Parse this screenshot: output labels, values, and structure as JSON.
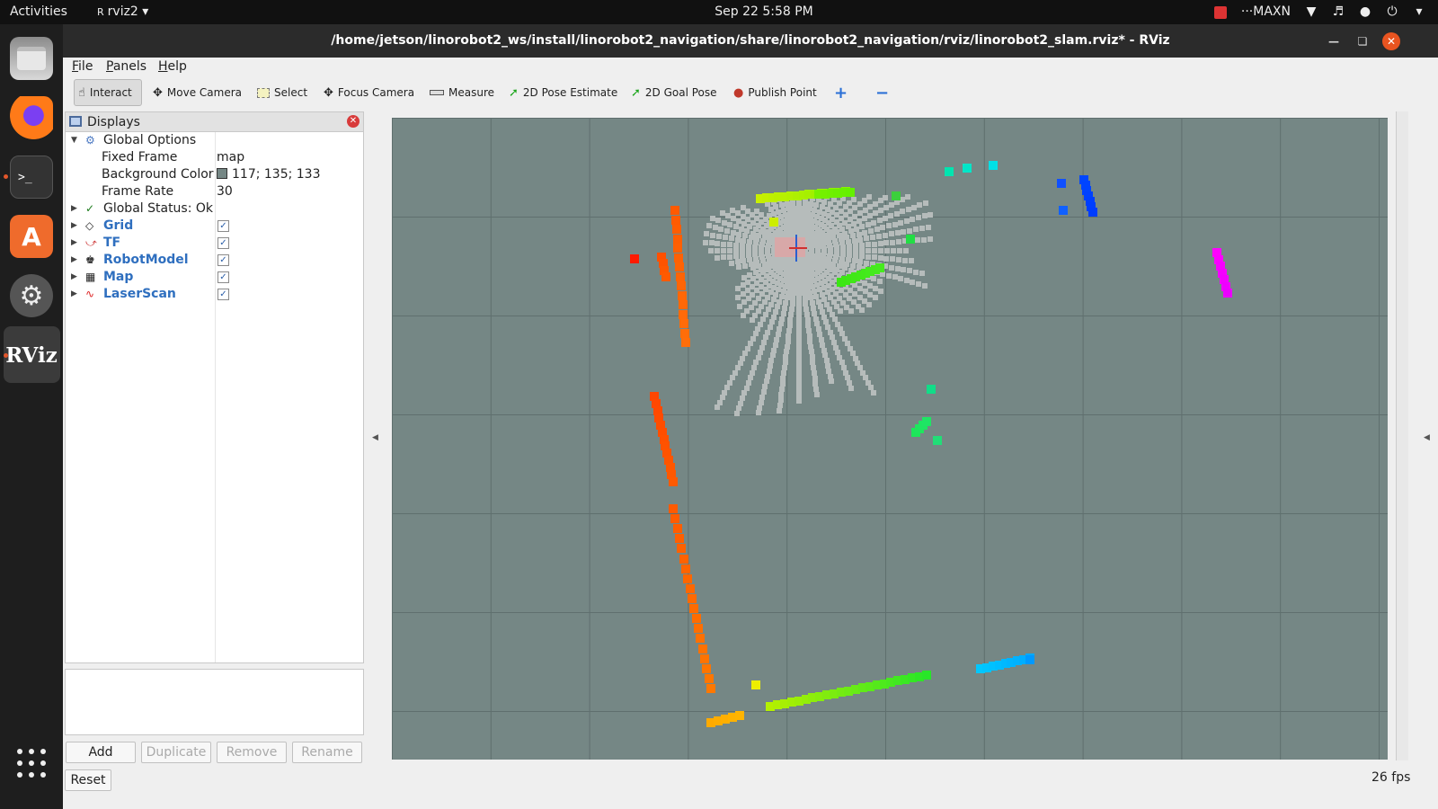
{
  "topbar": {
    "activities": "Activities",
    "app_name": "rviz2",
    "clock": "Sep 22  5:58 PM",
    "power_mode": "MAXN",
    "icons": [
      "jetson-status-icon",
      "wifi-icon",
      "volume-icon",
      "microphone-icon",
      "power-icon"
    ]
  },
  "dock": {
    "apps": [
      "Files",
      "Firefox",
      "Terminal",
      "Ubuntu Software",
      "Settings",
      "RViz"
    ],
    "rviz_label": "RViz",
    "terminal_glyph": ">_"
  },
  "window": {
    "title": "/home/jetson/linorobot2_ws/install/linorobot2_navigation/share/linorobot2_navigation/rviz/linorobot2_slam.rviz* - RViz"
  },
  "menu": {
    "file": "File",
    "panels": "Panels",
    "help": "Help"
  },
  "toolbar": {
    "interact": "Interact",
    "move_camera": "Move Camera",
    "select": "Select",
    "focus_camera": "Focus Camera",
    "measure": "Measure",
    "pose_estimate": "2D Pose Estimate",
    "goal_pose": "2D Goal Pose",
    "publish_point": "Publish Point"
  },
  "displays": {
    "title": "Displays",
    "global_options": "Global Options",
    "fixed_frame_label": "Fixed Frame",
    "fixed_frame_value": "map",
    "bg_color_label": "Background Color",
    "bg_color_value": "117; 135; 133",
    "frame_rate_label": "Frame Rate",
    "frame_rate_value": "30",
    "global_status": "Global Status: Ok",
    "items": [
      {
        "name": "Grid",
        "enabled": true
      },
      {
        "name": "TF",
        "enabled": true
      },
      {
        "name": "RobotModel",
        "enabled": true
      },
      {
        "name": "Map",
        "enabled": true
      },
      {
        "name": "LaserScan",
        "enabled": true
      }
    ]
  },
  "panel_buttons": {
    "add": "Add",
    "duplicate": "Duplicate",
    "remove": "Remove",
    "rename": "Rename",
    "reset": "Reset"
  },
  "status": {
    "fps": "26 fps"
  },
  "colors": {
    "background": "#758785",
    "grid": "#5f6f6e",
    "map_free": "#b6bcbb"
  }
}
